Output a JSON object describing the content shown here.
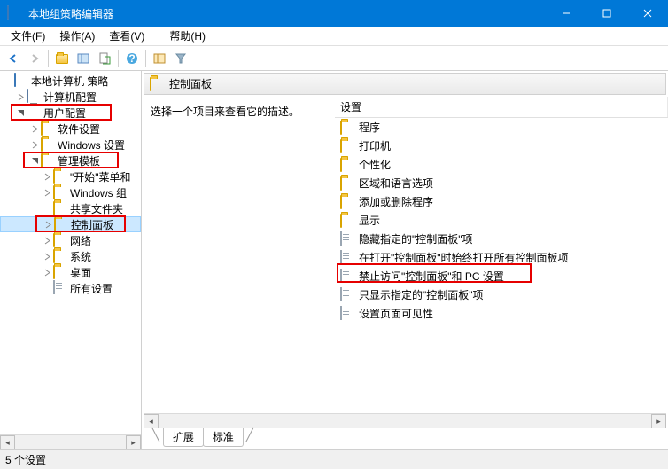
{
  "titlebar": {
    "title": "本地组策略编辑器"
  },
  "menubar": {
    "items": [
      "文件(F)",
      "操作(A)",
      "查看(V)",
      "帮助(H)"
    ]
  },
  "tree": {
    "root": "本地计算机 策略",
    "nodes": [
      {
        "label": "计算机配置",
        "indent": 1,
        "expander": "▷",
        "icon": "computer"
      },
      {
        "label": "用户配置",
        "indent": 1,
        "expander": "▽",
        "icon": "setting",
        "highlight": true
      },
      {
        "label": "软件设置",
        "indent": 2,
        "expander": "▷",
        "icon": "folder"
      },
      {
        "label": "Windows 设置",
        "indent": 2,
        "expander": "▷",
        "icon": "folder"
      },
      {
        "label": "管理模板",
        "indent": 2,
        "expander": "▽",
        "icon": "folder",
        "highlight": true
      },
      {
        "label": "\"开始\"菜单和",
        "indent": 3,
        "expander": "▷",
        "icon": "folder"
      },
      {
        "label": "Windows 组",
        "indent": 3,
        "expander": "▷",
        "icon": "folder"
      },
      {
        "label": "共享文件夹",
        "indent": 3,
        "expander": "",
        "icon": "folder"
      },
      {
        "label": "控制面板",
        "indent": 3,
        "expander": "▷",
        "icon": "folder",
        "selected": true,
        "highlight": true
      },
      {
        "label": "网络",
        "indent": 3,
        "expander": "▷",
        "icon": "folder"
      },
      {
        "label": "系统",
        "indent": 3,
        "expander": "▷",
        "icon": "folder"
      },
      {
        "label": "桌面",
        "indent": 3,
        "expander": "▷",
        "icon": "folder"
      },
      {
        "label": "所有设置",
        "indent": 3,
        "expander": "",
        "icon": "page"
      }
    ]
  },
  "content": {
    "header_title": "控制面板",
    "description": "选择一个项目来查看它的描述。",
    "list_header": "设置",
    "items": [
      {
        "label": "程序",
        "icon": "folder"
      },
      {
        "label": "打印机",
        "icon": "folder"
      },
      {
        "label": "个性化",
        "icon": "folder"
      },
      {
        "label": "区域和语言选项",
        "icon": "folder"
      },
      {
        "label": "添加或删除程序",
        "icon": "folder"
      },
      {
        "label": "显示",
        "icon": "folder"
      },
      {
        "label": "隐藏指定的\"控制面板\"项",
        "icon": "page"
      },
      {
        "label": "在打开\"控制面板\"时始终打开所有控制面板项",
        "icon": "page"
      },
      {
        "label": "禁止访问\"控制面板\"和 PC 设置",
        "icon": "page",
        "highlight": true
      },
      {
        "label": "只显示指定的\"控制面板\"项",
        "icon": "page"
      },
      {
        "label": "设置页面可见性",
        "icon": "page"
      }
    ]
  },
  "tabs": {
    "items": [
      "扩展",
      "标准"
    ]
  },
  "statusbar": {
    "text": "5 个设置"
  }
}
